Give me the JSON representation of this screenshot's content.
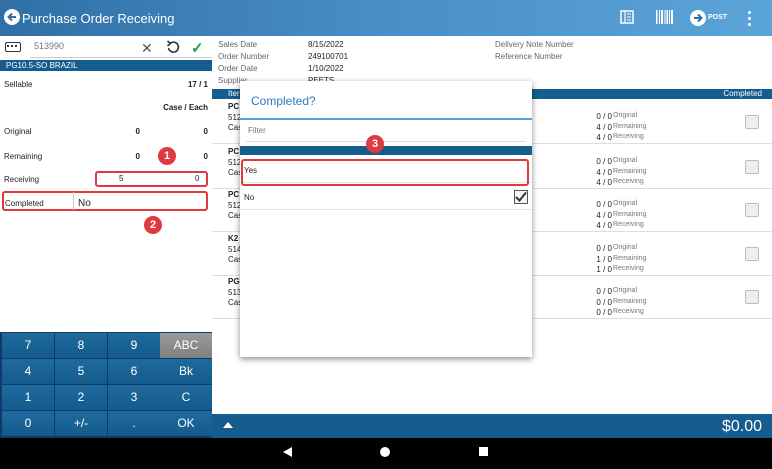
{
  "header": {
    "title": "Purchase Order Receiving",
    "post_label": "POST"
  },
  "left_panel": {
    "search_placeholder": "513990",
    "product": "PG10.5-SO BRAZIL",
    "sellable_label": "Sellable",
    "sellable_value": "17 / 1",
    "unit_header": "Case / Each",
    "rows": [
      {
        "label": "Original",
        "case": "0",
        "each": "0"
      },
      {
        "label": "Remaining",
        "case": "0",
        "each": "0"
      },
      {
        "label": "Receiving",
        "case": "5",
        "each": "0"
      }
    ],
    "completed_label": "Completed",
    "completed_value": "No"
  },
  "badges": [
    "1",
    "2",
    "3"
  ],
  "keypad": [
    [
      "7",
      "8",
      "9",
      "ABC"
    ],
    [
      "4",
      "5",
      "6",
      "Bk"
    ],
    [
      "1",
      "2",
      "3",
      "C"
    ],
    [
      "0",
      "+/-",
      ".",
      "OK"
    ]
  ],
  "order_info": {
    "sales_date_label": "Sales Date",
    "sales_date": "8/15/2022",
    "order_number_label": "Order Number",
    "order_number": "249100701",
    "order_date_label": "Order Date",
    "order_date": "1/10/2022",
    "supplier_label": "Supplier",
    "supplier": "PEETS",
    "delivery_note_label": "Delivery Note Number",
    "reference_label": "Reference Number"
  },
  "table": {
    "item_header": "Iter",
    "completed_header": "Completed",
    "quantity_labels": [
      "Original",
      "Remaining",
      "Receiving"
    ],
    "rows": [
      {
        "name": "PC",
        "code": "512",
        "unit": "Cas",
        "quantities": [
          "0 / 0",
          "4 / 0",
          "4 / 0"
        ]
      },
      {
        "name": "PC",
        "code": "512",
        "unit": "Cas",
        "quantities": [
          "0 / 0",
          "4 / 0",
          "4 / 0"
        ]
      },
      {
        "name": "PC",
        "code": "512",
        "unit": "Cas",
        "quantities": [
          "0 / 0",
          "4 / 0",
          "4 / 0"
        ]
      },
      {
        "name": "K2",
        "code": "514",
        "unit": "Cas",
        "quantities": [
          "0 / 0",
          "1 / 0",
          "1 / 0"
        ]
      },
      {
        "name": "PG",
        "code": "513",
        "unit": "Cas",
        "quantities": [
          "0 / 0",
          "0 / 0",
          "0 / 0"
        ]
      }
    ]
  },
  "footer": {
    "total": "$0.00"
  },
  "modal": {
    "title": "Completed?",
    "filter_placeholder": "Filter",
    "options": [
      "Yes",
      "No"
    ]
  },
  "colors": {
    "header_start": "#2f6fa6",
    "header_end": "#5ba4d8",
    "bar": "#155d8f",
    "highlight": "#e0393e",
    "accent": "#2f7bbd",
    "confirm": "#1aa04a"
  }
}
